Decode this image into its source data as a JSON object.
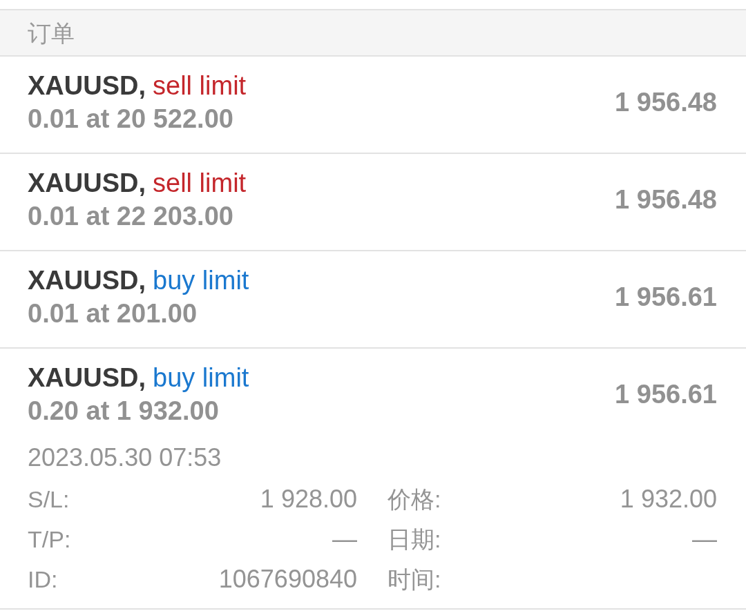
{
  "header": {
    "title": "订单"
  },
  "orders": [
    {
      "symbol": "XAUUSD,",
      "type": "sell limit",
      "kind": "sell",
      "volume_at_price": "0.01 at 20 522.00",
      "current_price": "1 956.48",
      "expanded": false
    },
    {
      "symbol": "XAUUSD,",
      "type": "sell limit",
      "kind": "sell",
      "volume_at_price": "0.01 at 22 203.00",
      "current_price": "1 956.48",
      "expanded": false
    },
    {
      "symbol": "XAUUSD,",
      "type": "buy limit",
      "kind": "buy",
      "volume_at_price": "0.01 at 201.00",
      "current_price": "1 956.61",
      "expanded": false
    },
    {
      "symbol": "XAUUSD,",
      "type": "buy limit",
      "kind": "buy",
      "volume_at_price": "0.20 at 1 932.00",
      "current_price": "1 956.61",
      "expanded": true,
      "time": "2023.05.30 07:53",
      "details": [
        {
          "label": "S/L:",
          "value": "1 928.00"
        },
        {
          "label": "价格:",
          "value": "1 932.00"
        },
        {
          "label": "T/P:",
          "value": "—"
        },
        {
          "label": "日期:",
          "value": "—"
        },
        {
          "label": "ID:",
          "value": "1067690840"
        },
        {
          "label": "时间:"
        }
      ]
    }
  ]
}
